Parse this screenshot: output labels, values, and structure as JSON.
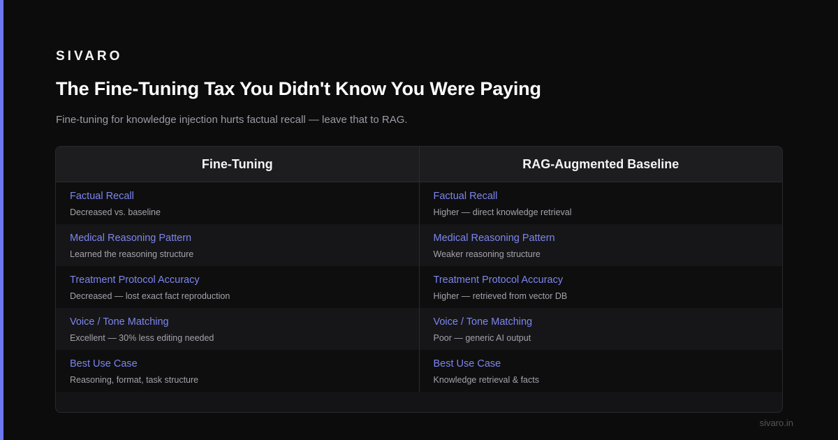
{
  "brand": "SIVARO",
  "title": "The Fine-Tuning Tax You Didn't Know You Were Paying",
  "subtitle": "Fine-tuning for knowledge injection hurts factual recall — leave that to RAG.",
  "table": {
    "columns": [
      "Fine-Tuning",
      "RAG-Augmented Baseline"
    ],
    "rows": [
      {
        "left": {
          "label": "Factual Recall",
          "value": "Decreased vs. baseline"
        },
        "right": {
          "label": "Factual Recall",
          "value": "Higher — direct knowledge retrieval"
        }
      },
      {
        "left": {
          "label": "Medical Reasoning Pattern",
          "value": "Learned the reasoning structure"
        },
        "right": {
          "label": "Medical Reasoning Pattern",
          "value": "Weaker reasoning structure"
        }
      },
      {
        "left": {
          "label": "Treatment Protocol Accuracy",
          "value": "Decreased — lost exact fact reproduction"
        },
        "right": {
          "label": "Treatment Protocol Accuracy",
          "value": "Higher — retrieved from vector DB"
        }
      },
      {
        "left": {
          "label": "Voice / Tone Matching",
          "value": "Excellent — 30% less editing needed"
        },
        "right": {
          "label": "Voice / Tone Matching",
          "value": "Poor — generic AI output"
        }
      },
      {
        "left": {
          "label": "Best Use Case",
          "value": "Reasoning, format, task structure"
        },
        "right": {
          "label": "Best Use Case",
          "value": "Knowledge retrieval & facts"
        }
      }
    ]
  },
  "footer": "sivaro.in",
  "colors": {
    "accent": "#6e78f0",
    "label": "#7d86ee",
    "background": "#0c0c0d"
  }
}
